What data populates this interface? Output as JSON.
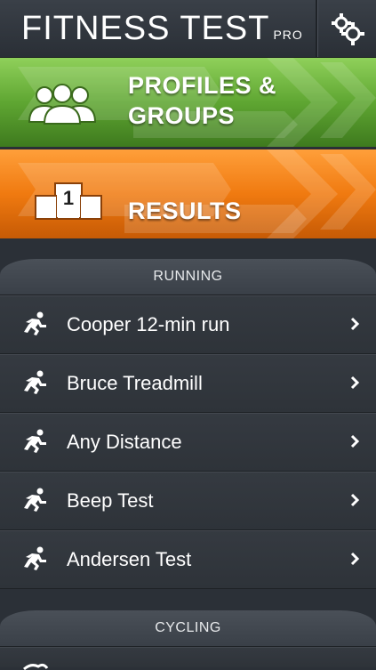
{
  "header": {
    "title": "FITNESS TEST",
    "title_suffix": "PRO",
    "settings_icon": "gears-icon"
  },
  "banners": [
    {
      "label_line1": "PROFILES &",
      "label_line2": "GROUPS",
      "icon": "people-icon",
      "color": "#5fa632"
    },
    {
      "label": "RESULTS",
      "icon": "podium-icon",
      "podium_number": "1",
      "color": "#f07a10"
    }
  ],
  "sections": [
    {
      "title": "RUNNING",
      "items": [
        {
          "label": "Cooper 12-min run",
          "icon": "runner-icon"
        },
        {
          "label": "Bruce Treadmill",
          "icon": "runner-icon"
        },
        {
          "label": "Any Distance",
          "icon": "runner-icon"
        },
        {
          "label": "Beep Test",
          "icon": "runner-icon"
        },
        {
          "label": "Andersen Test",
          "icon": "runner-icon"
        }
      ]
    },
    {
      "title": "CYCLING",
      "items": []
    }
  ],
  "colors": {
    "background": "#2b3037",
    "green": "#5fa632",
    "orange": "#f07a10"
  }
}
